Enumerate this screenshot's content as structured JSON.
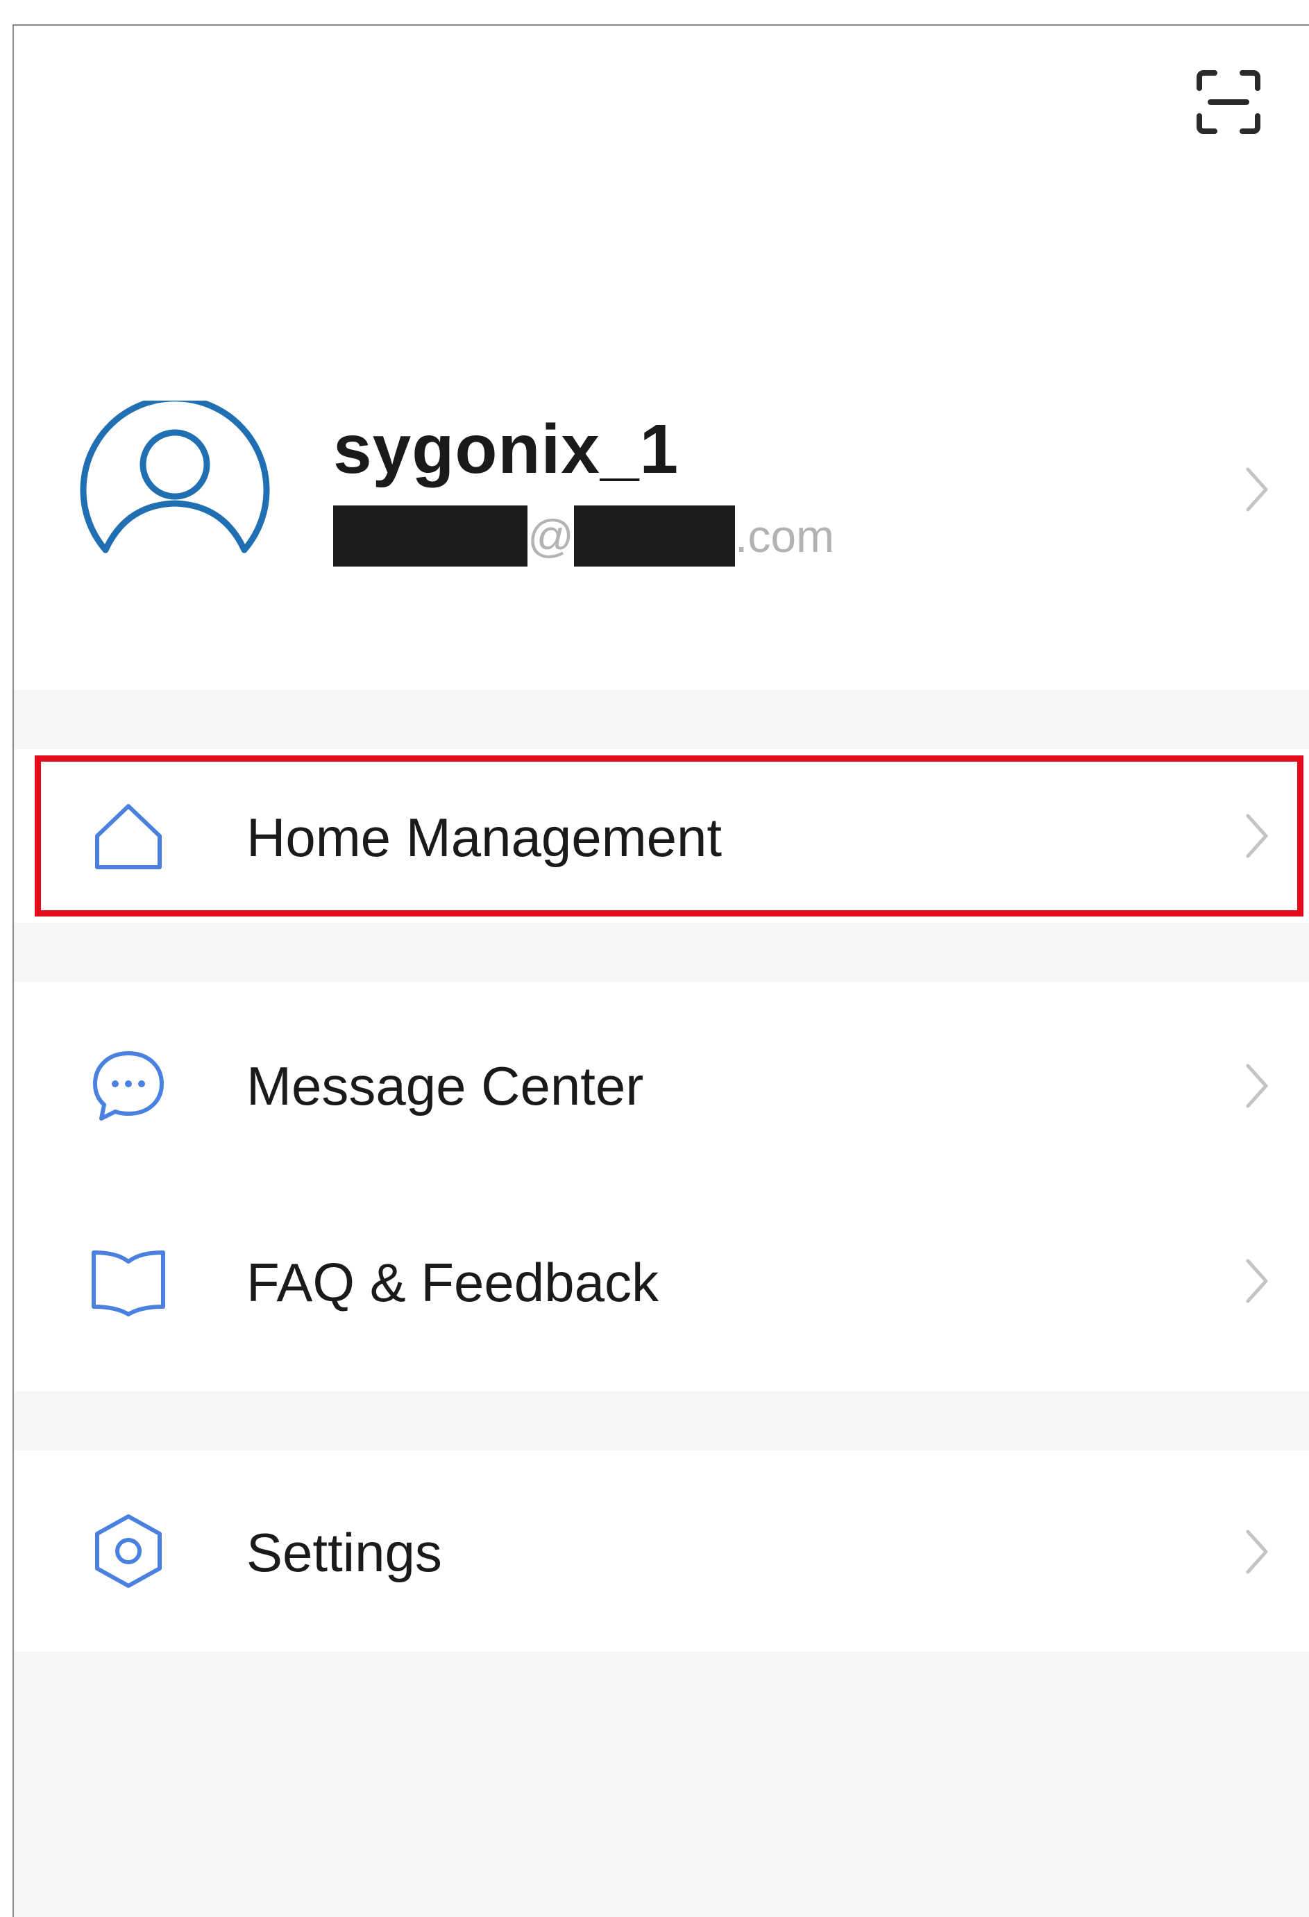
{
  "header": {
    "scan_icon": "scan-icon"
  },
  "profile": {
    "username": "sygonix_1",
    "email_at": "@",
    "email_suffix": ".com",
    "avatar_icon": "user-avatar-icon",
    "avatar_color": "#1f6fb2"
  },
  "menu": {
    "home_management": {
      "label": "Home Management",
      "icon": "home-icon"
    },
    "message_center": {
      "label": "Message Center",
      "icon": "chat-bubble-icon"
    },
    "faq_feedback": {
      "label": "FAQ & Feedback",
      "icon": "book-icon"
    },
    "settings": {
      "label": "Settings",
      "icon": "settings-icon"
    }
  },
  "colors": {
    "icon_accent": "#4a80e0",
    "highlight_border": "#e30b1c",
    "section_gap": "#f6f6f6"
  }
}
